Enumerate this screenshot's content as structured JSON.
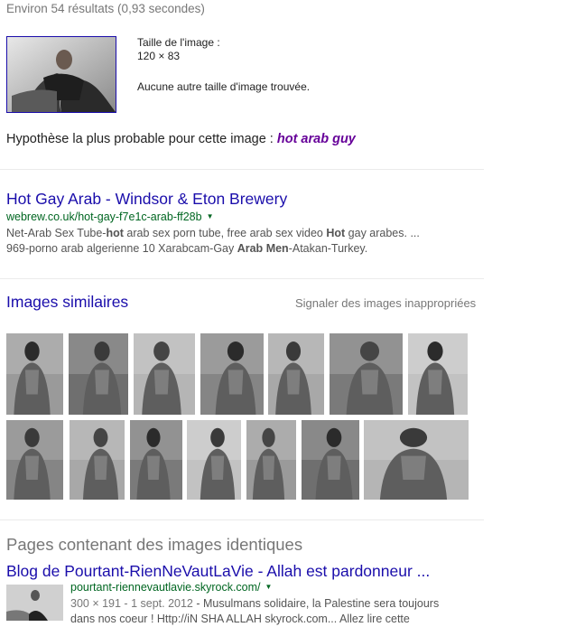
{
  "stats": "Environ 54 résultats (0,93 secondes)",
  "query_image": {
    "size_label": "Taille de l'image :",
    "size_value": "120 × 83",
    "other_sizes": "Aucune autre taille d'image trouvée."
  },
  "best_guess": {
    "label": "Hypothèse la plus probable pour cette image : ",
    "query": "hot arab guy"
  },
  "result1": {
    "title": "Hot Gay Arab - Windsor & Eton Brewery",
    "url": "webrew.co.uk/hot-gay-f7e1c-arab-ff28b",
    "snippet_parts": [
      {
        "t": "Net-Arab Sex Tube-",
        "b": false
      },
      {
        "t": "hot",
        "b": true
      },
      {
        "t": " arab sex porn tube, free arab sex video ",
        "b": false
      },
      {
        "t": "Hot",
        "b": true
      },
      {
        "t": " gay arabes. ...",
        "b": false
      },
      {
        "t": "\n969-porno arab algerienne 10 Xarabcam-Gay ",
        "b": false
      },
      {
        "t": "Arab",
        "b": true
      },
      {
        "t": " ",
        "b": false
      },
      {
        "t": "Men",
        "b": true
      },
      {
        "t": "-Atakan-Turkey.",
        "b": false
      }
    ]
  },
  "similar": {
    "title": "Images similaires",
    "report": "Signaler des images inappropriées",
    "row1_count": 7,
    "row2_count": 7
  },
  "identical_pages": {
    "title": "Pages contenant des images identiques",
    "result_title": "Blog de Pourtant-RienNeVautLaVie - Allah est pardonneur ...",
    "result_url": "pourtant-riennevautlavie.skyrock.com/",
    "meta": "300 × 191 - 1 sept. 2012",
    "snippet_line1": " - Musulmans solidaire, la Palestine sera toujours",
    "snippet_line2": "dans nos coeur ! Http://iN SHA ALLAH skyrock.com... Allez lire cette"
  }
}
